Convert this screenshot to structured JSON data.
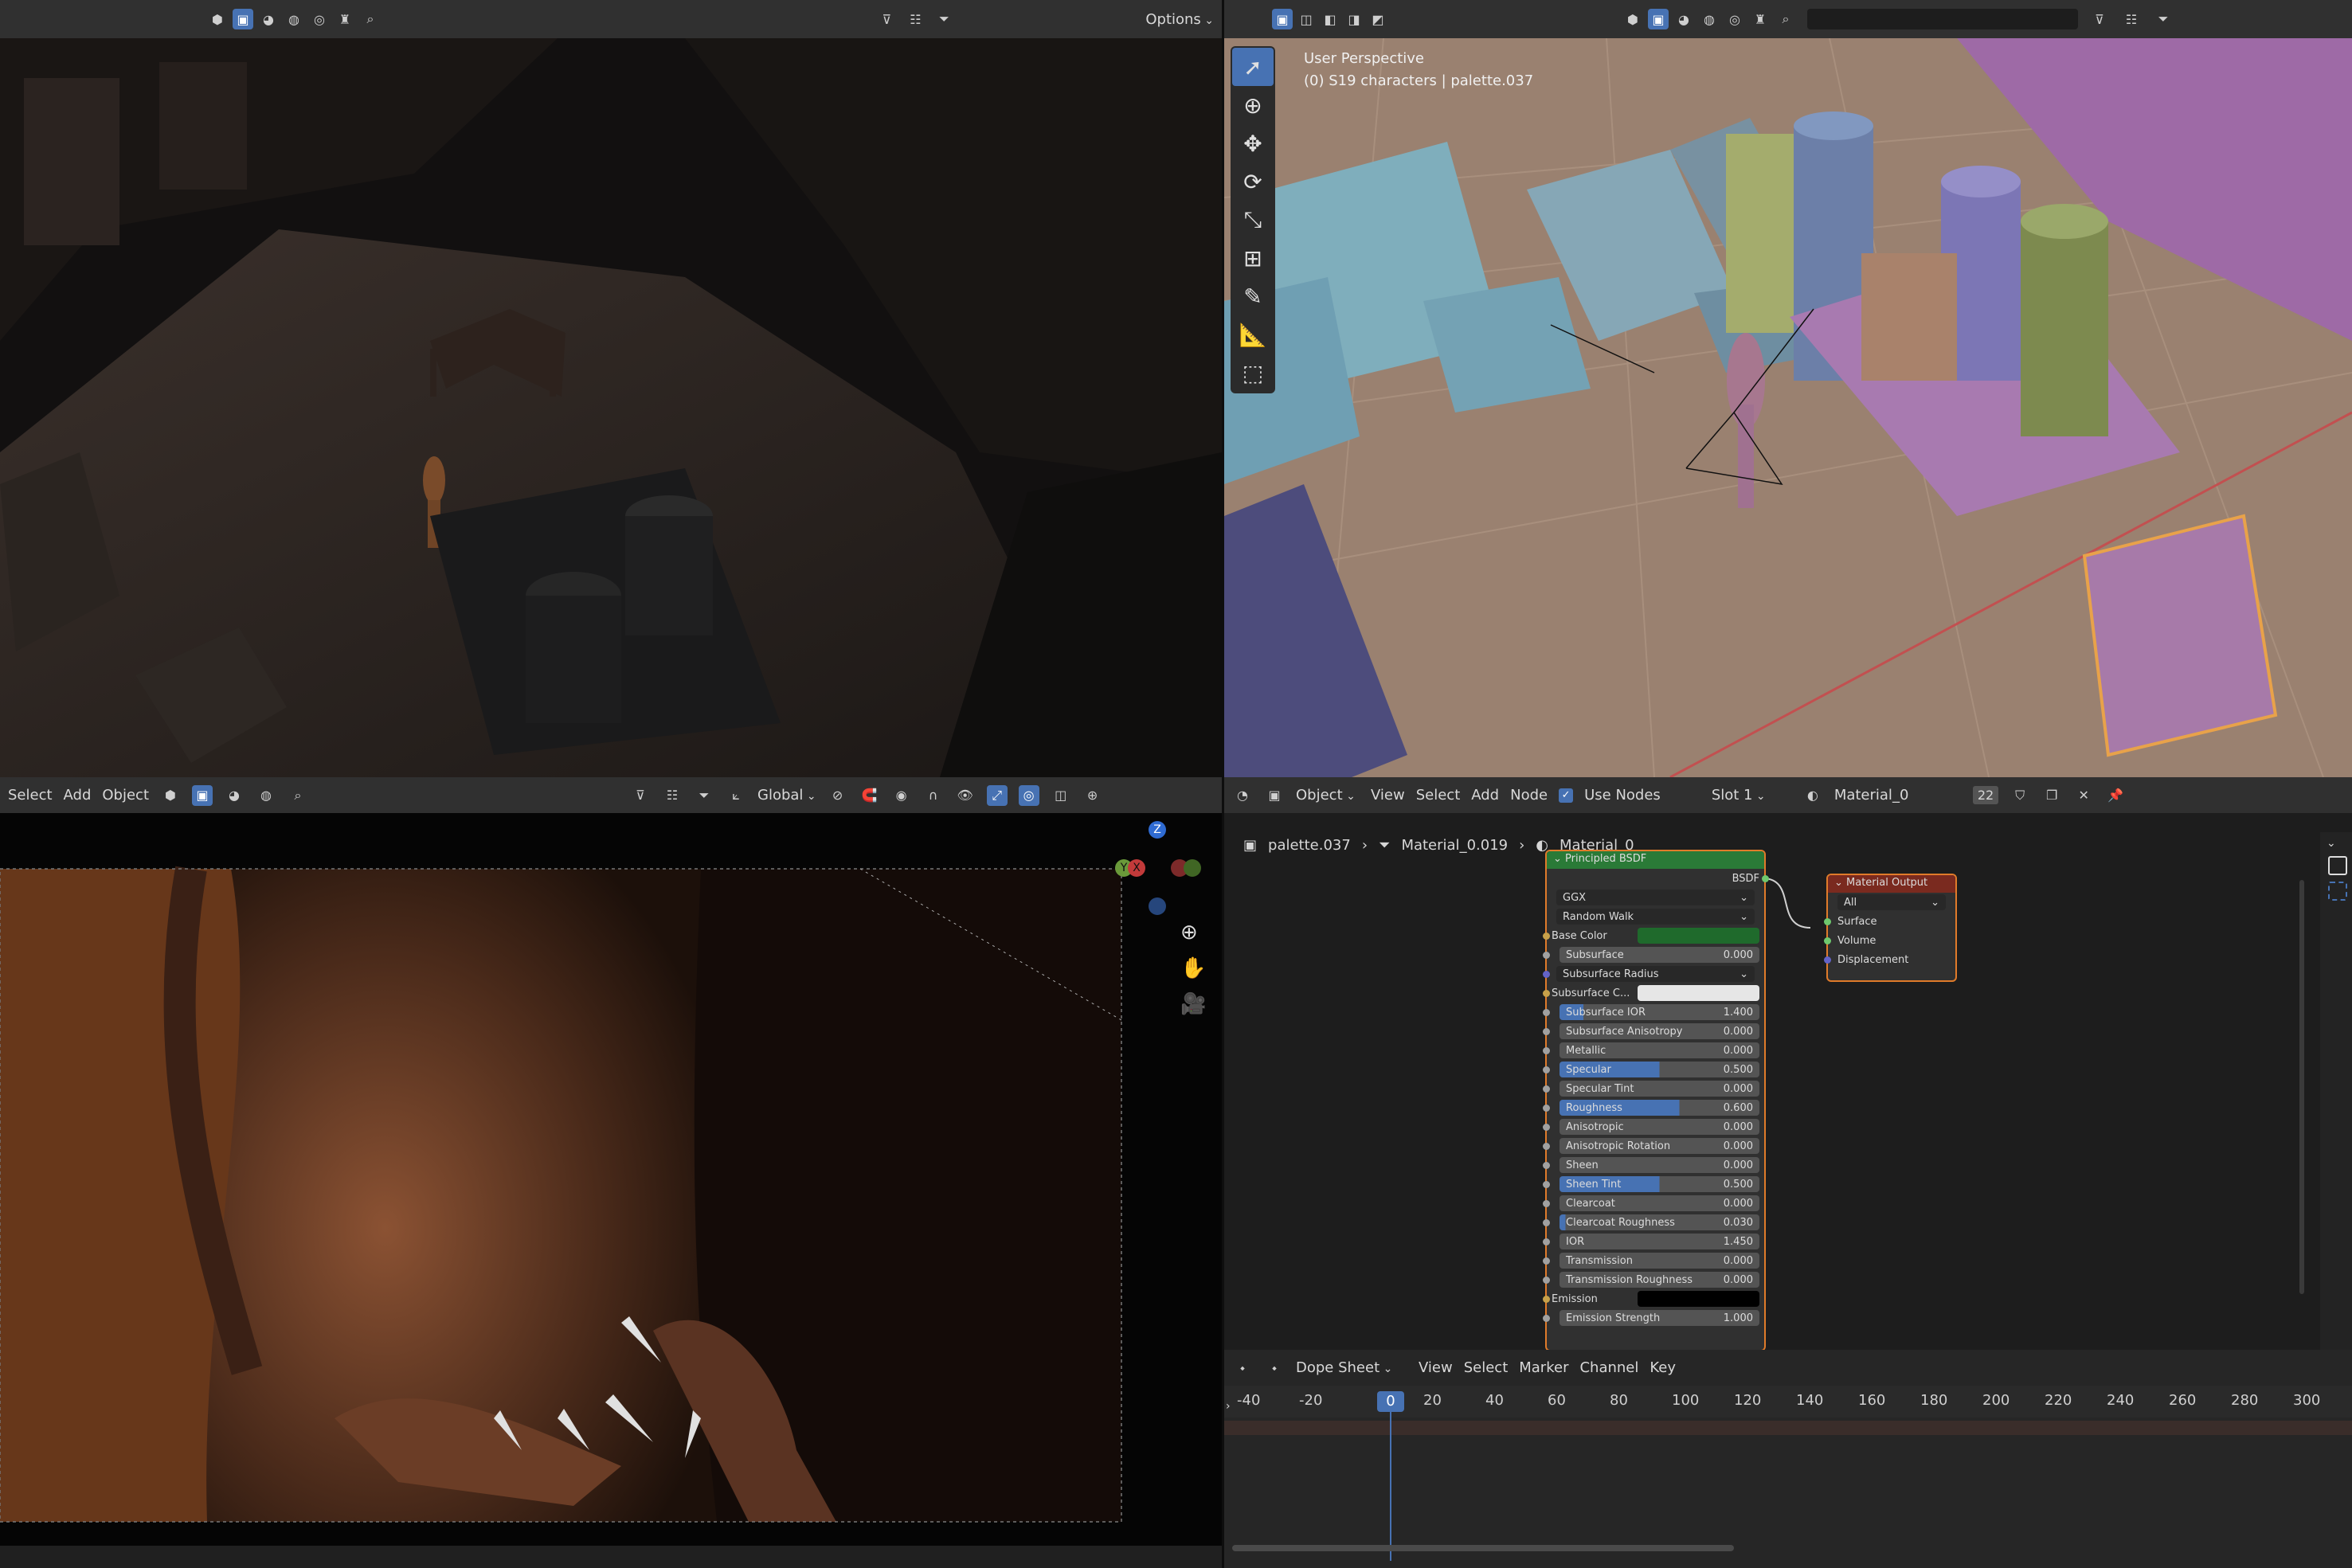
{
  "top_left_header": {
    "options_label": "Options"
  },
  "top_right_viewport": {
    "perspective_label": "User Perspective",
    "object_info": "(0) S19 characters | palette.037"
  },
  "bottom_left_header": {
    "menu": [
      "Select",
      "Add",
      "Object"
    ],
    "transform_orientation": "Global"
  },
  "node_editor": {
    "header": {
      "mode": "Object",
      "menu": [
        "View",
        "Select",
        "Add",
        "Node"
      ],
      "use_nodes_label": "Use Nodes",
      "slot": "Slot 1",
      "material": "Material_0",
      "user_count": "22"
    },
    "breadcrumb": [
      "palette.037",
      "Material_0.019",
      "Material_0"
    ],
    "bsdf_node": {
      "title": "Principled BSDF",
      "output_label": "BSDF",
      "distribution": "GGX",
      "subsurface_method": "Random Walk",
      "rows": [
        {
          "label": "Base Color",
          "type": "color",
          "color": "#1f6a2c"
        },
        {
          "label": "Subsurface",
          "value": "0.000",
          "fill": 0
        },
        {
          "label": "Subsurface Radius",
          "type": "dropdown"
        },
        {
          "label": "Subsurface C...",
          "type": "color",
          "color": "#e6e6e6"
        },
        {
          "label": "Subsurface IOR",
          "value": "1.400",
          "fill": 0.12
        },
        {
          "label": "Subsurface Anisotropy",
          "value": "0.000",
          "fill": 0
        },
        {
          "label": "Metallic",
          "value": "0.000",
          "fill": 0
        },
        {
          "label": "Specular",
          "value": "0.500",
          "fill": 0.5
        },
        {
          "label": "Specular Tint",
          "value": "0.000",
          "fill": 0
        },
        {
          "label": "Roughness",
          "value": "0.600",
          "fill": 0.6
        },
        {
          "label": "Anisotropic",
          "value": "0.000",
          "fill": 0
        },
        {
          "label": "Anisotropic Rotation",
          "value": "0.000",
          "fill": 0
        },
        {
          "label": "Sheen",
          "value": "0.000",
          "fill": 0
        },
        {
          "label": "Sheen Tint",
          "value": "0.500",
          "fill": 0.5
        },
        {
          "label": "Clearcoat",
          "value": "0.000",
          "fill": 0
        },
        {
          "label": "Clearcoat Roughness",
          "value": "0.030",
          "fill": 0.03
        },
        {
          "label": "IOR",
          "value": "1.450",
          "fill": 0
        },
        {
          "label": "Transmission",
          "value": "0.000",
          "fill": 0
        },
        {
          "label": "Transmission Roughness",
          "value": "0.000",
          "fill": 0
        },
        {
          "label": "Emission",
          "type": "color",
          "color": "#000000"
        },
        {
          "label": "Emission Strength",
          "value": "1.000",
          "fill": 0
        }
      ]
    },
    "output_node": {
      "title": "Material Output",
      "target": "All",
      "inputs": [
        "Surface",
        "Volume",
        "Displacement"
      ]
    }
  },
  "dope_sheet": {
    "mode": "Dope Sheet",
    "menu": [
      "View",
      "Select",
      "Marker",
      "Channel",
      "Key"
    ],
    "current_frame": "0",
    "frame_ticks": [
      "-40",
      "-20",
      "0",
      "20",
      "40",
      "60",
      "80",
      "100",
      "120",
      "140",
      "160",
      "180",
      "200",
      "220",
      "240",
      "260",
      "280",
      "300"
    ]
  },
  "colors": {
    "accent": "#4772b3",
    "bsdf_header": "#2a7a37",
    "output_header": "#7a2a1f"
  }
}
